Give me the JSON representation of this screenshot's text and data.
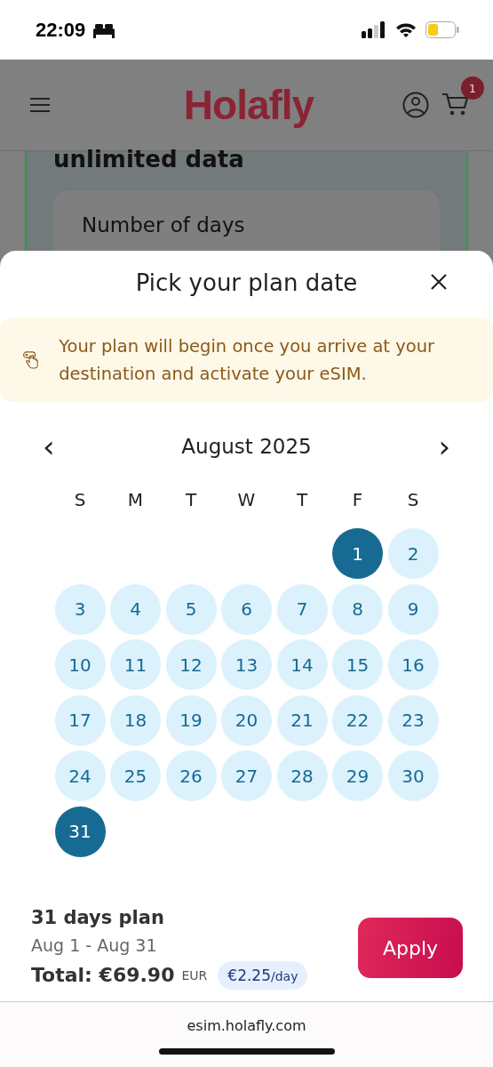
{
  "status_bar": {
    "time": "22:09"
  },
  "header": {
    "logo": "Holafly",
    "cart_count": "1"
  },
  "background": {
    "heading": "unlimited data",
    "card_label": "Number of days"
  },
  "sheet": {
    "title": "Pick your plan date",
    "notice": "Your plan will begin once you arrive at your destination and activate your eSIM.",
    "calendar": {
      "prev": "‹",
      "month": "August 2025",
      "next": "›",
      "weekdays": [
        "S",
        "M",
        "T",
        "W",
        "T",
        "F",
        "S"
      ],
      "weeks": [
        {
          "days": [
            {
              "day": "1",
              "selected": true
            },
            {
              "day": "2",
              "selected": false
            }
          ]
        },
        {
          "days": [
            {
              "day": "3",
              "selected": false
            },
            {
              "day": "4",
              "selected": false
            },
            {
              "day": "5",
              "selected": false
            },
            {
              "day": "6",
              "selected": false
            },
            {
              "day": "7",
              "selected": false
            },
            {
              "day": "8",
              "selected": false
            },
            {
              "day": "9",
              "selected": false
            }
          ]
        },
        {
          "days": [
            {
              "day": "10",
              "selected": false
            },
            {
              "day": "11",
              "selected": false
            },
            {
              "day": "12",
              "selected": false
            },
            {
              "day": "13",
              "selected": false
            },
            {
              "day": "14",
              "selected": false
            },
            {
              "day": "15",
              "selected": false
            },
            {
              "day": "16",
              "selected": false
            }
          ]
        },
        {
          "days": [
            {
              "day": "17",
              "selected": false
            },
            {
              "day": "18",
              "selected": false
            },
            {
              "day": "19",
              "selected": false
            },
            {
              "day": "20",
              "selected": false
            },
            {
              "day": "21",
              "selected": false
            },
            {
              "day": "22",
              "selected": false
            },
            {
              "day": "23",
              "selected": false
            }
          ]
        },
        {
          "days": [
            {
              "day": "24",
              "selected": false
            },
            {
              "day": "25",
              "selected": false
            },
            {
              "day": "26",
              "selected": false
            },
            {
              "day": "27",
              "selected": false
            },
            {
              "day": "28",
              "selected": false
            },
            {
              "day": "29",
              "selected": false
            },
            {
              "day": "30",
              "selected": false
            }
          ]
        },
        {
          "days": [
            {
              "day": "31",
              "selected": true
            }
          ]
        }
      ]
    },
    "summary": {
      "plan": "31 days plan",
      "range": "Aug 1 - Aug 31",
      "total_label": "Total:",
      "total": "€69.90",
      "currency": "EUR",
      "per_day": "€2.25",
      "per_day_unit": "/day"
    },
    "apply": "Apply"
  },
  "browser": {
    "url": "esim.holafly.com"
  }
}
